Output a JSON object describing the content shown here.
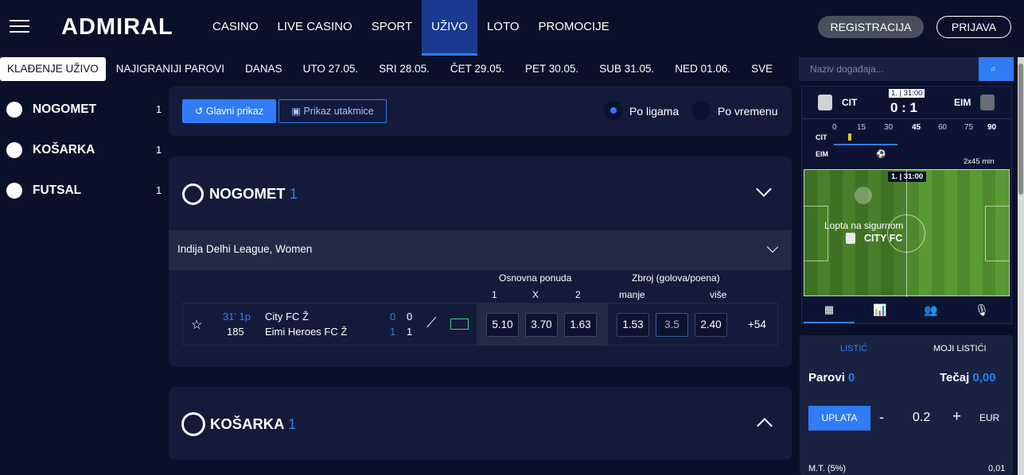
{
  "brand": "ADMIRAL",
  "nav": [
    "CASINO",
    "LIVE CASINO",
    "SPORT",
    "UŽIVO",
    "LOTO",
    "PROMOCIJE"
  ],
  "nav_active": "UŽIVO",
  "auth": {
    "register": "REGISTRACIJA",
    "login": "PRIJAVA"
  },
  "subnav": [
    "KLAĐENJE UŽIVO",
    "NAJIGRANIJI PAROVI",
    "DANAS",
    "UTO 27.05.",
    "SRI 28.05.",
    "ČET 29.05.",
    "PET 30.05.",
    "SUB 31.05.",
    "NED 01.06.",
    "SVE"
  ],
  "sports": [
    {
      "name": "NOGOMET",
      "count": "1"
    },
    {
      "name": "KOŠARKA",
      "count": "1"
    },
    {
      "name": "FUTSAL",
      "count": "1"
    }
  ],
  "view": {
    "main_btn": "Glavni prikaz",
    "match_btn": "Prikaz utakmice",
    "radio_league": "Po ligama",
    "radio_time": "Po vremenu"
  },
  "football": {
    "title": "NOGOMET",
    "count": "1"
  },
  "league": "Indija Delhi League, Women",
  "headers": {
    "basic": "Osnovna ponuda",
    "total": "Zbroj (golova/poena)",
    "h1": "1",
    "hx": "X",
    "h2": "2",
    "under": "manje",
    "over": "više"
  },
  "match": {
    "time": "31' 1p",
    "code": "185",
    "home": "City FC Ž",
    "away": "Eimi Heroes FC Ž",
    "home_ht": "0",
    "away_ht": "1",
    "home_score": "0",
    "away_score": "1",
    "odd1": "5.10",
    "oddx": "3.70",
    "odd2": "1.63",
    "under": "1.53",
    "line": "3.5",
    "over": "2.40",
    "more": "+54"
  },
  "basketball": {
    "title": "KOŠARKA",
    "count": "1"
  },
  "search_placeholder": "Naziv događaja...",
  "widget": {
    "home": "CIT",
    "away": "EIM",
    "period": "1. | 31:00",
    "score": "0 : 1",
    "ticks": [
      "0",
      "15",
      "30",
      "45",
      "60",
      "75",
      "90"
    ],
    "duration": "2x45 min",
    "field_clock_period": "1.",
    "field_clock_time": "31:00",
    "status": "Lopta na sigurnom",
    "team": "CITY FC"
  },
  "slip": {
    "tab1": "LISTIĆ",
    "tab2": "MOJI LISTIĆI",
    "pairs_label": "Parovi",
    "pairs": "0",
    "odds_label": "Tečaj",
    "odds": "0,00",
    "pay_btn": "UPLATA",
    "minus": "-",
    "stake": "0.2",
    "plus": "+",
    "currency": "EUR",
    "mt_label": "M.T. (5%)",
    "mt_value": "0,01"
  }
}
